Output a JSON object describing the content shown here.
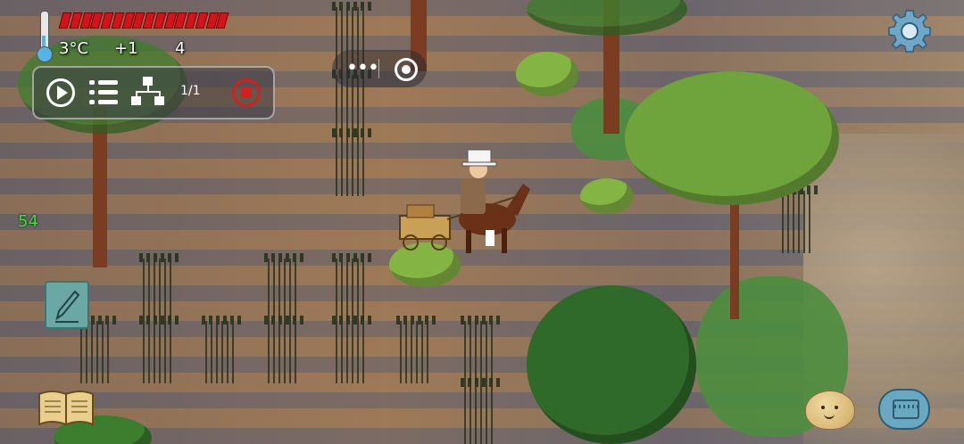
{
  "hud": {
    "temperature": "3°C",
    "temp_change": "+1",
    "food_count": "4",
    "health_fraction": 1.0
  },
  "toolbar": {
    "page_counter": "1/1"
  },
  "fps": "54",
  "icons": {
    "thermometer": "thermometer-icon",
    "settings": "gear-icon",
    "play": "play-icon",
    "list": "list-icon",
    "hierarchy": "hierarchy-icon",
    "stop": "stop-record-icon",
    "more": "more-dots-icon",
    "target": "target-icon",
    "note": "pencil-icon",
    "book": "book-icon",
    "emote": "potato-emote-icon",
    "keyboard": "keyboard-icon"
  },
  "colors": {
    "health": "#d2141a",
    "fps": "#42e23c",
    "stop": "#d02020",
    "thermometer_fill": "#56b3e6"
  }
}
